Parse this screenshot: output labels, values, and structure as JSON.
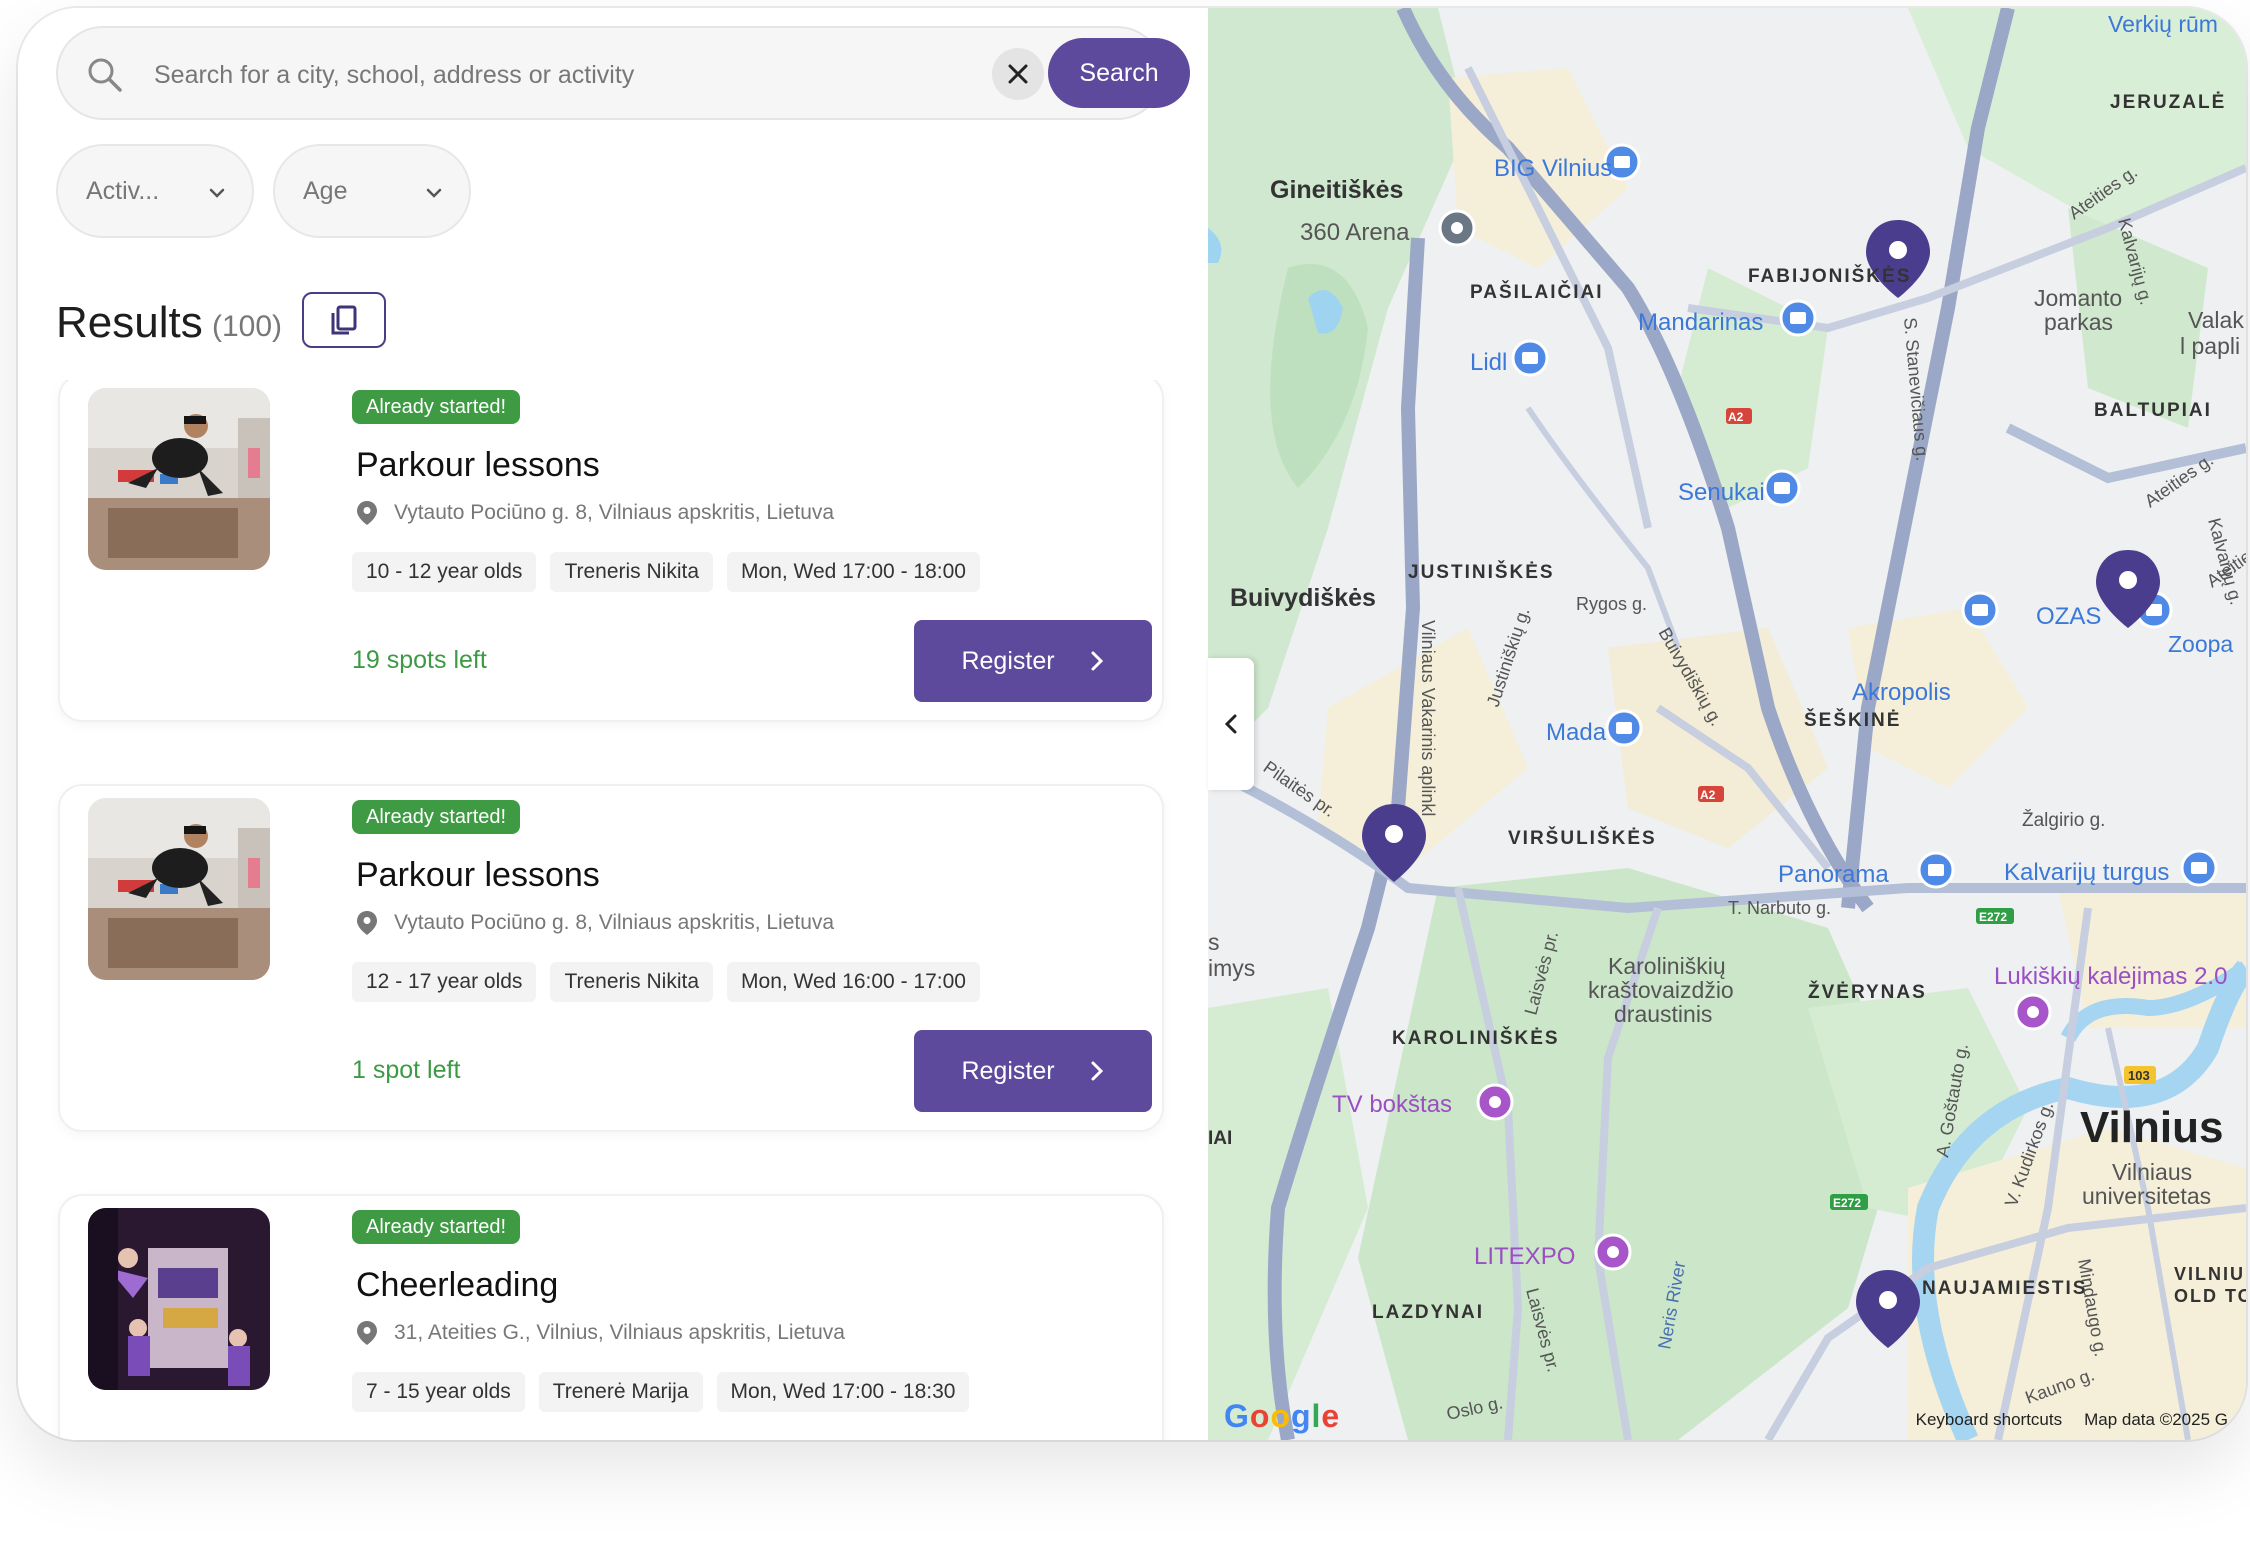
{
  "search": {
    "placeholder": "Search for a city, school, address or activity",
    "button_label": "Search"
  },
  "filters": {
    "activity_label": "Activ...",
    "age_label": "Age"
  },
  "results": {
    "title": "Results",
    "count": "(100)"
  },
  "cards": [
    {
      "badge": "Already started!",
      "title": "Parkour lessons",
      "address": "Vytauto Pociūno g. 8, Vilniaus apskritis, Lietuva",
      "chips": [
        "10 - 12 year olds",
        "Treneris Nikita",
        "Mon, Wed 17:00 - 18:00"
      ],
      "spots": "19 spots left",
      "register_label": "Register"
    },
    {
      "badge": "Already started!",
      "title": "Parkour lessons",
      "address": "Vytauto Pociūno g. 8, Vilniaus apskritis, Lietuva",
      "chips": [
        "12 - 17 year olds",
        "Treneris Nikita",
        "Mon, Wed 16:00 - 17:00"
      ],
      "spots": "1 spot left",
      "register_label": "Register"
    },
    {
      "badge": "Already started!",
      "title": "Cheerleading",
      "address": "31, Ateities G., Vilnius, Vilniaus apskritis, Lietuva",
      "chips": [
        "7 - 15 year olds",
        "Trenerė Marija",
        "Mon, Wed 17:00 - 18:30"
      ],
      "spots": "",
      "register_label": ""
    }
  ],
  "map": {
    "labels": {
      "gineitiskes": "Gineitiškės",
      "arena": "360 Arena",
      "big_vilnius": "BIG Vilnius",
      "pasilaiciai": "PAŠILAIČIAI",
      "fabijoniskes": "FABIJONIŠKĖS",
      "mandarinas": "Mandarinas",
      "lidl": "Lidl",
      "senukai": "Senukai",
      "justiniskes": "JUSTINIŠKĖS",
      "buivydiskes": "Buivydiškės",
      "rygos": "Rygos g.",
      "ozas": "OZAS",
      "akropolis": "Akropolis",
      "seskine": "ŠEŠKINĖ",
      "mada": "Mada",
      "virsuliskes": "VIRŠULIŠKĖS",
      "zalgirio": "Žalgirio g.",
      "panorama": "Panorama",
      "kalvariju_turgus": "Kalvarijų turgus",
      "narbuto": "T. Narbuto g.",
      "karoliniskiu": "Karoliniškių",
      "krastovaizdzio": "kraštovaizdžio",
      "draustinis": "draustinis",
      "zverynas": "ŽVĖRYNAS",
      "lukiskiu": "Lukiškių kalėjimas 2.0",
      "karoliniskes": "KAROLINIŠKĖS",
      "tv_bokstas": "TV bokštas",
      "vilnius": "Vilnius",
      "vilniaus": "Vilniaus",
      "universitetas": "universitetas",
      "litexpo": "LITEXPO",
      "lazdynai": "LAZDYNAI",
      "naujamiestis": "NAUJAMIESTIS",
      "neris": "Neris River",
      "jeruzale": "JERUZALĖ",
      "baltupiai": "BALTUPIAI",
      "jomanto": "Jomanto",
      "parkas": "parkas",
      "ateities": "Ateities g.",
      "kalvariju_g": "Kalvarijų g.",
      "verkiu": "Verkių rūm",
      "valak": "Valak",
      "papli": "l papli",
      "zoopa": "Zoopa",
      "vilniu": "VILNIU",
      "old_to": "OLD TO",
      "kauno": "Kauno g.",
      "oslo": "Oslo g.",
      "imys": "imys",
      "iai": "IAI",
      "s_letter": "s",
      "a2": "A2",
      "e272": "E272",
      "r103": "103",
      "vakarinis": "Vilniaus Vakarinis aplinkl",
      "justiniskiu_g": "Justiniškių g.",
      "buivydiskiu_g": "Buivydiškių g.",
      "pilaites": "Pilaitės pr.",
      "laisves": "Laisvės pr.",
      "stanevicius": "S. Stanevičiaus g.",
      "gostauto": "A. Goštauto g.",
      "kudirkos": "V. Kudirkos g.",
      "mindaugo": "Mindaugo g."
    },
    "keyboard_shortcuts": "Keyboard shortcuts",
    "map_data": "Map data ©2025 G",
    "google": [
      "G",
      "o",
      "o",
      "g",
      "l",
      "e"
    ]
  },
  "colors": {
    "brand_purple": "#5d4a9c",
    "badge_green": "#3f9a44",
    "spots_green": "#3d9a44"
  }
}
